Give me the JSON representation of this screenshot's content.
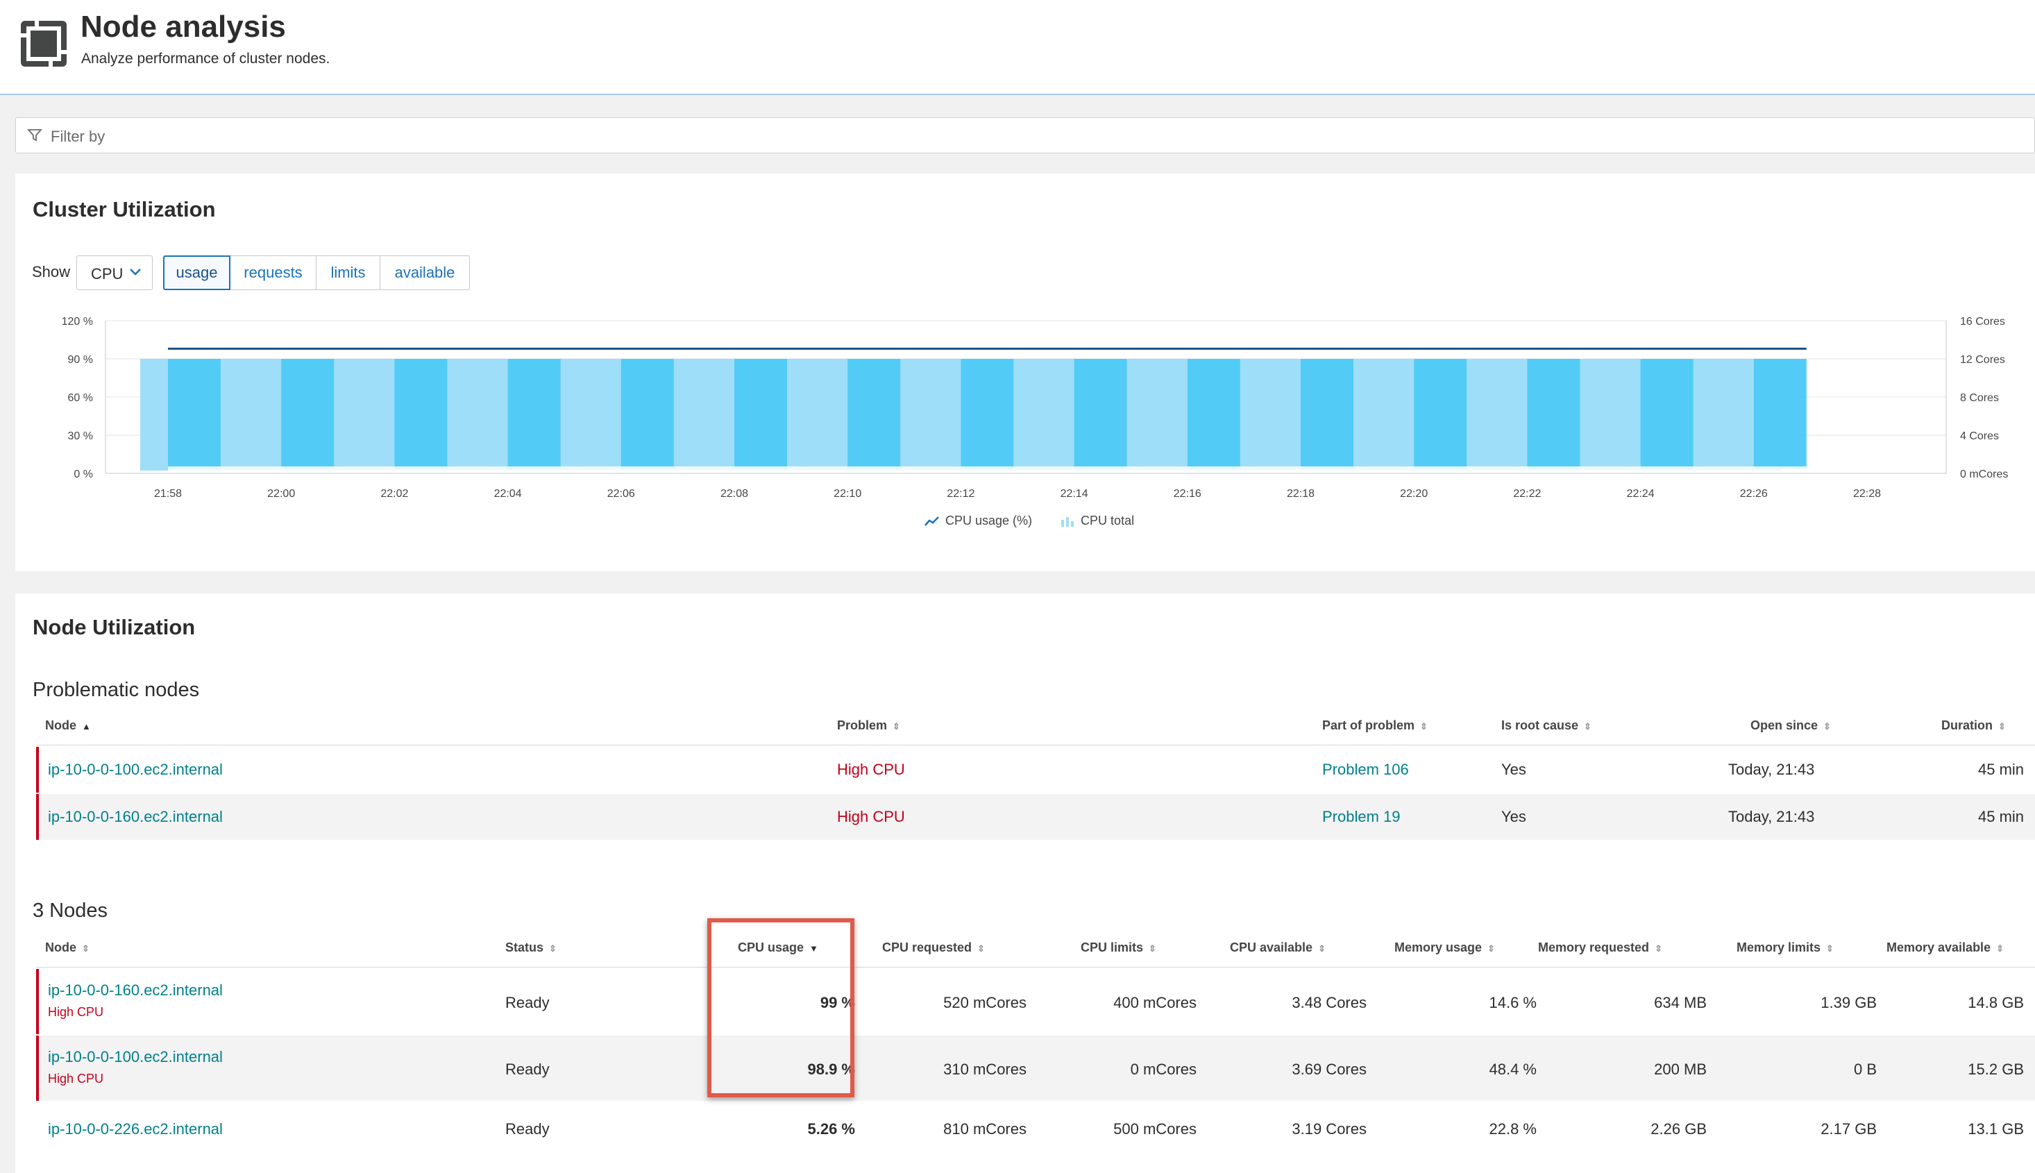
{
  "header": {
    "title": "Node analysis",
    "subtitle": "Analyze performance of cluster nodes."
  },
  "filter": {
    "placeholder": "Filter by"
  },
  "cluster": {
    "title": "Cluster Utilization",
    "show_label": "Show",
    "metric_selected": "CPU",
    "tabs": [
      "usage",
      "requests",
      "limits",
      "available"
    ],
    "active_tab": "usage",
    "legend": {
      "usage": "CPU usage (%)",
      "total": "CPU total"
    }
  },
  "chart_data": {
    "type": "bar",
    "x_ticks": [
      "21:58",
      "22:00",
      "22:02",
      "22:04",
      "22:06",
      "22:08",
      "22:10",
      "22:12",
      "22:14",
      "22:16",
      "22:18",
      "22:20",
      "22:22",
      "22:24",
      "22:26",
      "22:28"
    ],
    "y_left_ticks": [
      "120 %",
      "90 %",
      "60 %",
      "30 %",
      "0 %"
    ],
    "y_right_ticks": [
      "16 Cores",
      "12 Cores",
      "8 Cores",
      "4 Cores",
      "0 mCores"
    ],
    "ylim_left": [
      0,
      120
    ],
    "ylim_right": [
      0,
      16
    ],
    "series": [
      {
        "name": "CPU usage (%)",
        "type": "line",
        "values": [
          98,
          98,
          98,
          98,
          98,
          98,
          98,
          98,
          98,
          98,
          98,
          98,
          98,
          98,
          98
        ]
      },
      {
        "name": "CPU total",
        "type": "bar",
        "values": [
          12,
          12,
          12,
          12,
          12,
          12,
          12,
          12,
          12,
          12,
          12,
          12,
          12,
          12,
          12
        ]
      }
    ],
    "grid": true,
    "legend_position": "bottom-center"
  },
  "node_utilization": {
    "title": "Node Utilization",
    "problematic": {
      "title": "Problematic nodes",
      "headers": [
        "Node",
        "Problem",
        "Part of problem",
        "Is root cause",
        "Open since",
        "Duration"
      ],
      "rows": [
        {
          "node": "ip-10-0-0-100.ec2.internal",
          "problem": "High CPU",
          "part": "Problem 106",
          "root": "Yes",
          "since": "Today, 21:43",
          "duration": "45 min"
        },
        {
          "node": "ip-10-0-0-160.ec2.internal",
          "problem": "High CPU",
          "part": "Problem 19",
          "root": "Yes",
          "since": "Today, 21:43",
          "duration": "45 min"
        }
      ]
    },
    "nodes": {
      "title": "3 Nodes",
      "headers": [
        "Node",
        "Status",
        "CPU usage",
        "CPU requested",
        "CPU limits",
        "CPU available",
        "Memory usage",
        "Memory requested",
        "Memory limits",
        "Memory available"
      ],
      "rows": [
        {
          "node": "ip-10-0-0-160.ec2.internal",
          "tag": "High CPU",
          "status": "Ready",
          "cpu_usage": "99 %",
          "cpu_req": "520 mCores",
          "cpu_lim": "400 mCores",
          "cpu_avail": "3.48 Cores",
          "mem_usage": "14.6 %",
          "mem_req": "634 MB",
          "mem_lim": "1.39 GB",
          "mem_avail": "14.8 GB"
        },
        {
          "node": "ip-10-0-0-100.ec2.internal",
          "tag": "High CPU",
          "status": "Ready",
          "cpu_usage": "98.9 %",
          "cpu_req": "310 mCores",
          "cpu_lim": "0 mCores",
          "cpu_avail": "3.69 Cores",
          "mem_usage": "48.4 %",
          "mem_req": "200 MB",
          "mem_lim": "0 B",
          "mem_avail": "15.2 GB"
        },
        {
          "node": "ip-10-0-0-226.ec2.internal",
          "tag": "",
          "status": "Ready",
          "cpu_usage": "5.26 %",
          "cpu_req": "810 mCores",
          "cpu_lim": "500 mCores",
          "cpu_avail": "3.19 Cores",
          "mem_usage": "22.8 %",
          "mem_req": "2.26 GB",
          "mem_lim": "2.17 GB",
          "mem_avail": "13.1 GB"
        }
      ]
    }
  },
  "colors": {
    "accent": "#1a73b8",
    "link": "#00808a",
    "problem": "#c4001a",
    "bar_dark": "#52ccf7",
    "bar_light": "#9fdef8",
    "highlight": "#e05a4a"
  }
}
